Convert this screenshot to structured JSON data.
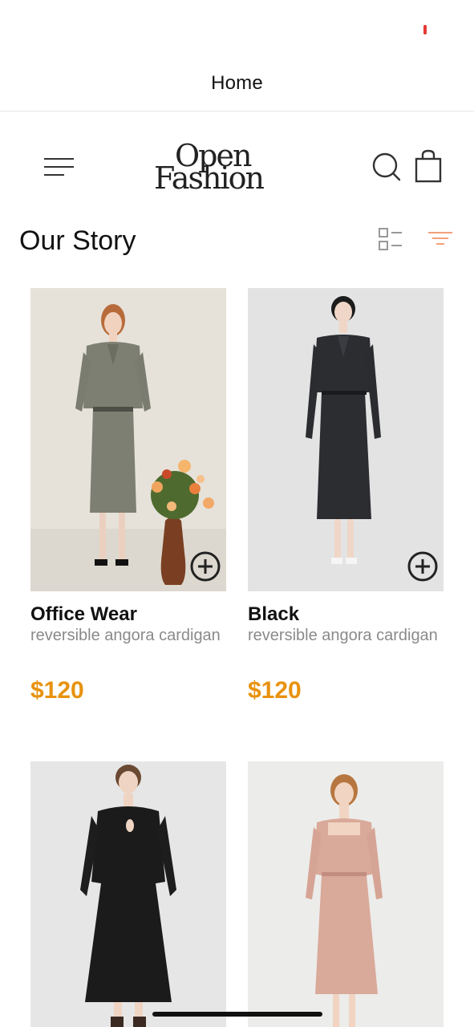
{
  "nav": {
    "title": "Home"
  },
  "header": {
    "logo_line1": "Open",
    "logo_line2": "Fashion"
  },
  "section": {
    "title": "Our Story"
  },
  "products": [
    {
      "name": "Office Wear",
      "desc": "reversible angora cardigan",
      "price": "$120"
    },
    {
      "name": "Black",
      "desc": "reversible angora cardigan",
      "price": "$120"
    }
  ],
  "colors": {
    "price": "#e8920f",
    "filter_accent": "#f4a07a",
    "status_dot": "#e53935"
  }
}
